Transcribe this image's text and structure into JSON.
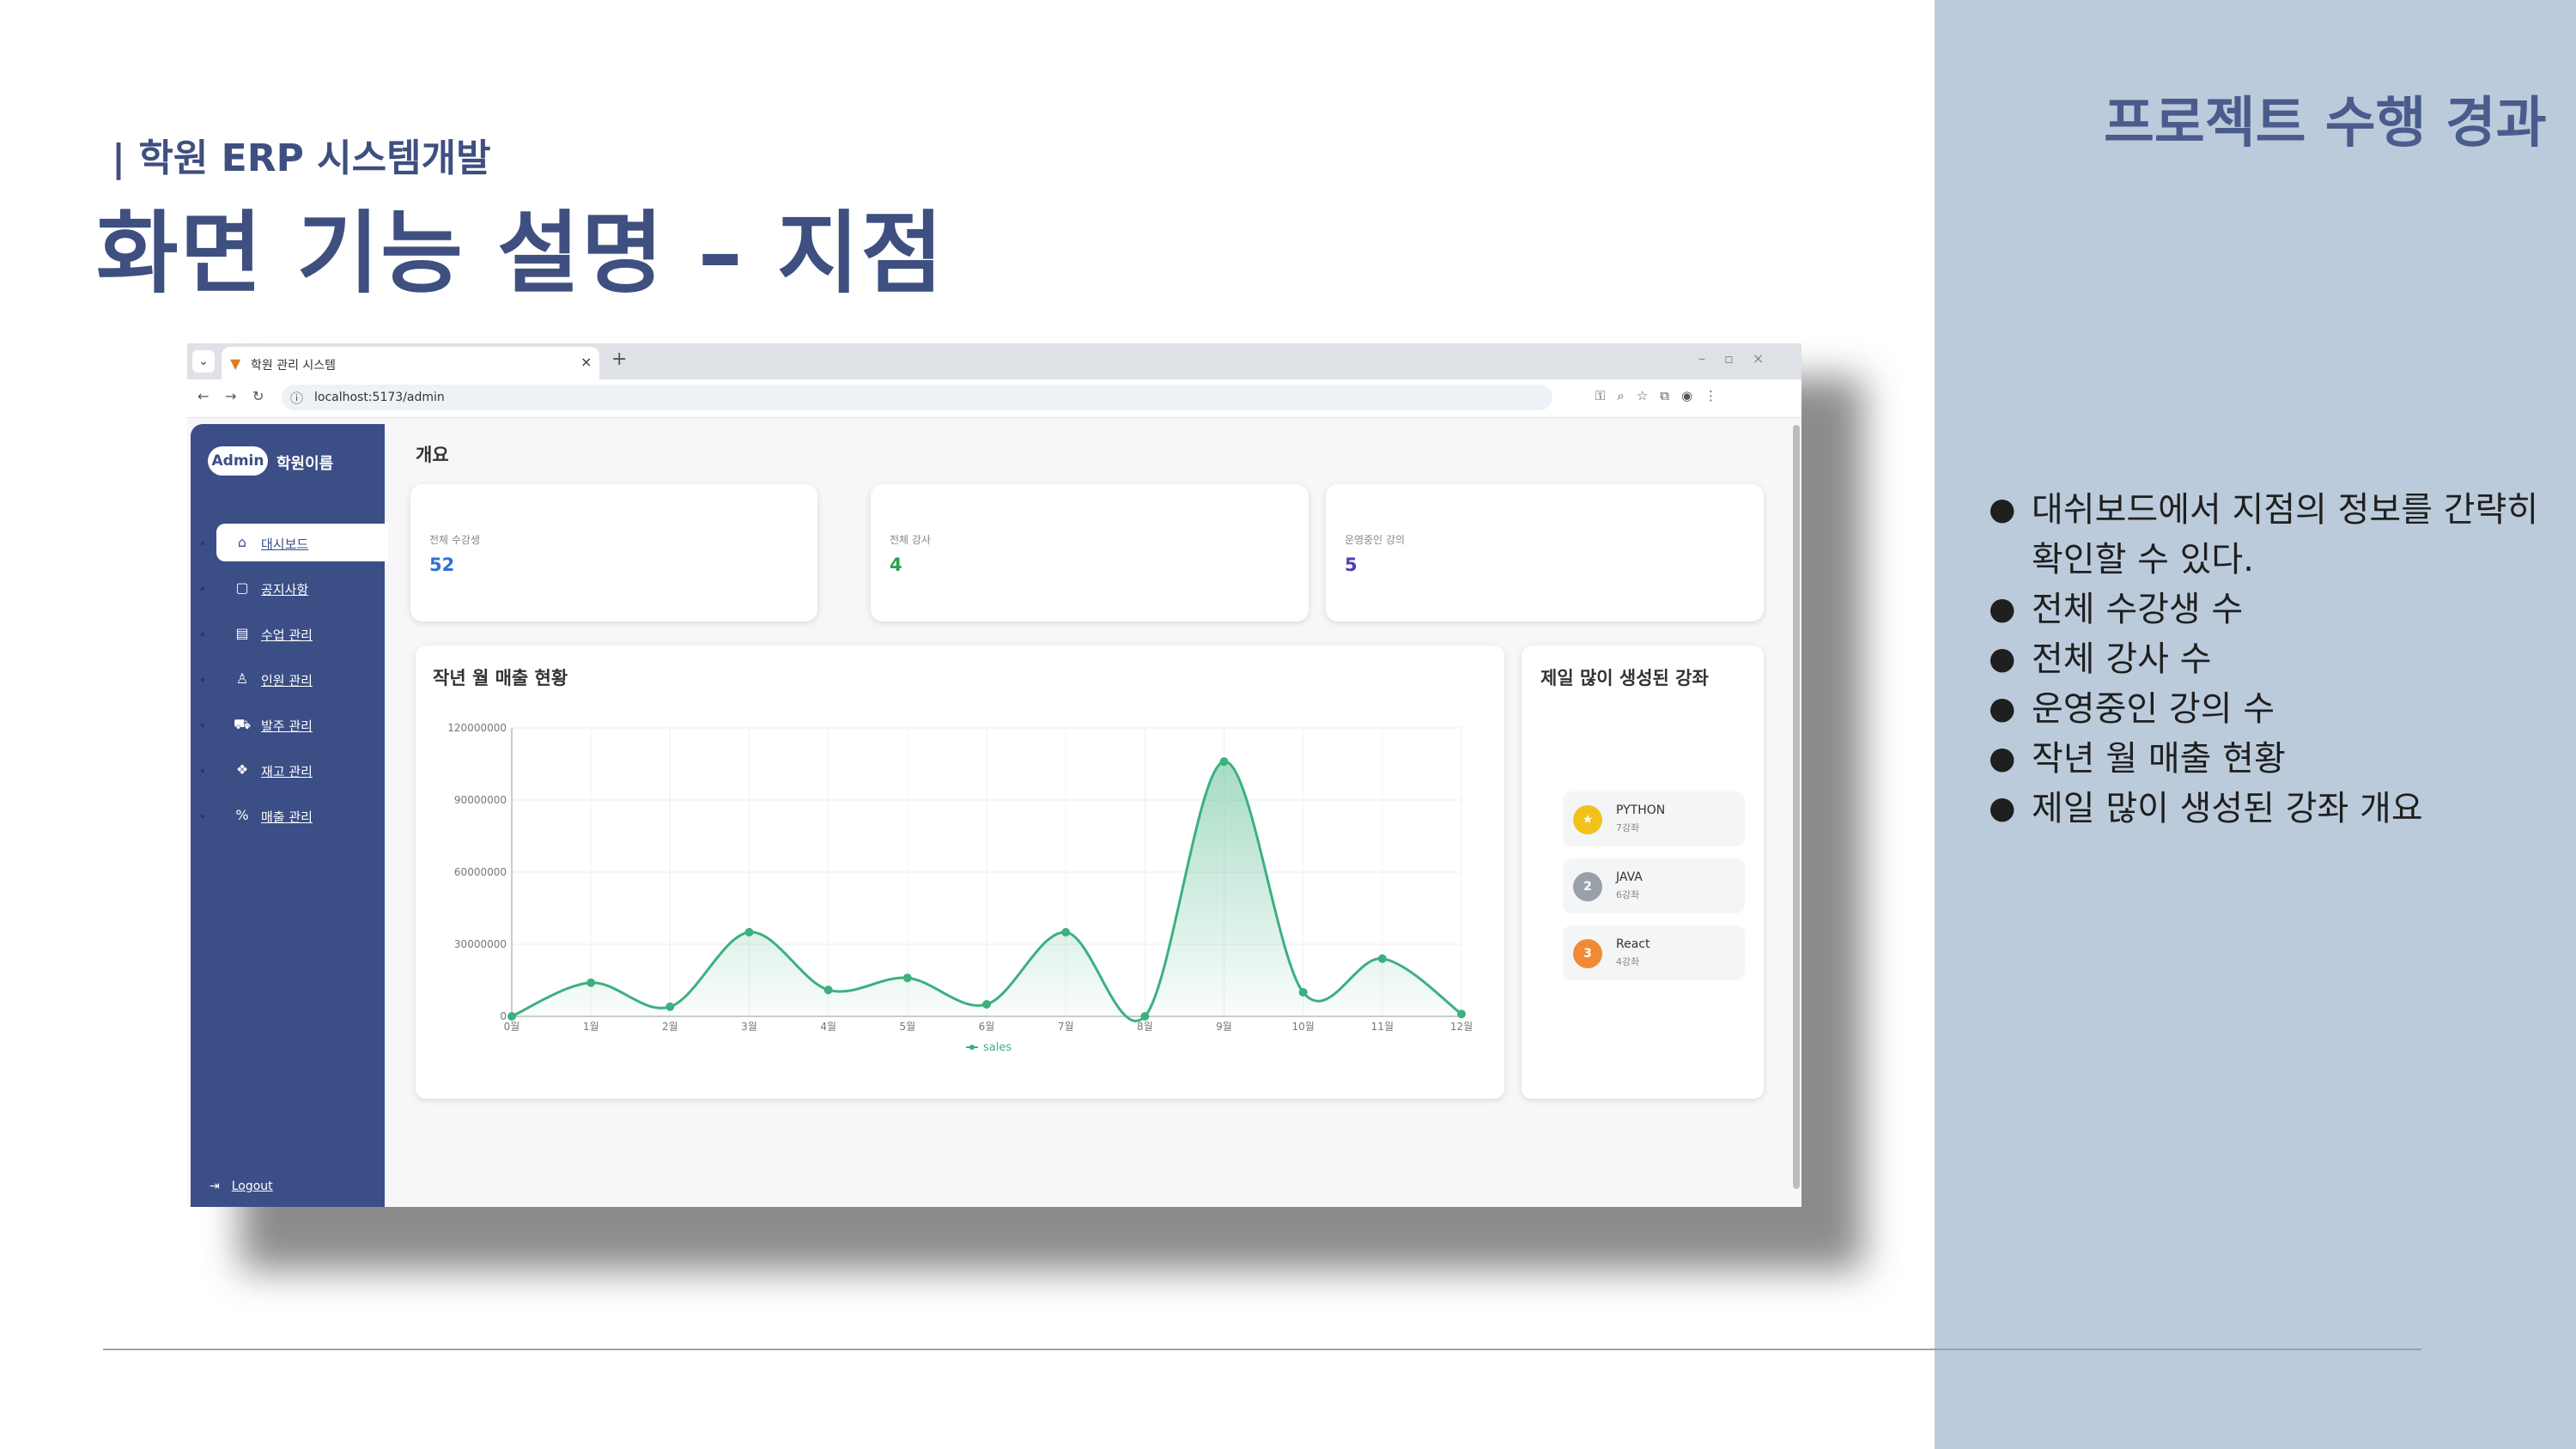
{
  "slide": {
    "kicker": "프로젝트 수행 경과",
    "subtitle": "| 학원 ERP 시스템개발",
    "title": "화면 기능 설명 – 지점",
    "bullets": [
      "대쉬보드에서 지점의 정보를 간략히 확인할 수 있다.",
      "전체 수강생 수",
      "전체 강사 수",
      "운영중인 강의 수",
      "작년 월 매출 현황",
      "제일 많이 생성된 강좌 개요"
    ],
    "colors": {
      "panel": "#bccbdb",
      "title": "#3e4f80"
    }
  },
  "browser": {
    "tab_title": "학원 관리 시스템",
    "url": "localhost:5173/admin",
    "icons": [
      "menu-icon",
      "favicon-icon",
      "close-icon",
      "new-tab-icon",
      "back-icon",
      "forward-icon",
      "reload-icon",
      "info-icon",
      "key-icon",
      "zoom-icon",
      "star-icon",
      "extensions-icon",
      "profile-icon",
      "kebab-menu-icon"
    ]
  },
  "sidebar": {
    "brand_badge": "Admin",
    "brand_name": "학원이름",
    "items": [
      {
        "label": "대시보드",
        "icon": "home-icon",
        "glyph": "⌂",
        "active": true
      },
      {
        "label": "공지사항",
        "icon": "document-icon",
        "glyph": "▢",
        "active": false
      },
      {
        "label": "수업 관리",
        "icon": "calendar-icon",
        "glyph": "▤",
        "active": false
      },
      {
        "label": "인원 관리",
        "icon": "user-icon",
        "glyph": "♙",
        "active": false
      },
      {
        "label": "발주 관리",
        "icon": "cart-icon",
        "glyph": "⛟",
        "active": false
      },
      {
        "label": "재고 관리",
        "icon": "boxes-icon",
        "glyph": "❖",
        "active": false
      },
      {
        "label": "매출 관리",
        "icon": "percent-icon",
        "glyph": "%",
        "active": false
      }
    ],
    "logout": "Logout",
    "color": "#3b4e86"
  },
  "main": {
    "title": "개요",
    "stats": [
      {
        "label": "전체 수강생",
        "value": "52",
        "color": "#2f6fd6"
      },
      {
        "label": "전체 강사",
        "value": "4",
        "color": "#2e9e4f"
      },
      {
        "label": "운영중인 강의",
        "value": "5",
        "color": "#4a3fb0"
      }
    ],
    "ranking": {
      "title": "제일 많이 생성된 강좌",
      "items": [
        {
          "rank": "★",
          "name": "PYTHON",
          "count": "7강좌",
          "color": "#f2c21b"
        },
        {
          "rank": "2",
          "name": "JAVA",
          "count": "6강좌",
          "color": "#9aa0a8"
        },
        {
          "rank": "3",
          "name": "React",
          "count": "4강좌",
          "color": "#f08a34"
        }
      ]
    }
  },
  "chart_data": {
    "type": "line",
    "title": "작년 월 매출 현황",
    "x": [
      "0월",
      "1월",
      "2월",
      "3월",
      "4월",
      "5월",
      "6월",
      "7월",
      "8월",
      "9월",
      "10월",
      "11월",
      "12월"
    ],
    "series": [
      {
        "name": "sales",
        "values": [
          0,
          14000000,
          4000000,
          35000000,
          11000000,
          16000000,
          5000000,
          35000000,
          0,
          106000000,
          10000000,
          24000000,
          1000000
        ]
      }
    ],
    "ylim": [
      0,
      120000000
    ],
    "yticks": [
      "0",
      "30000000",
      "60000000",
      "90000000",
      "120000000"
    ],
    "grid": true,
    "legend": "bottom-center",
    "color": "#3cb07f"
  }
}
